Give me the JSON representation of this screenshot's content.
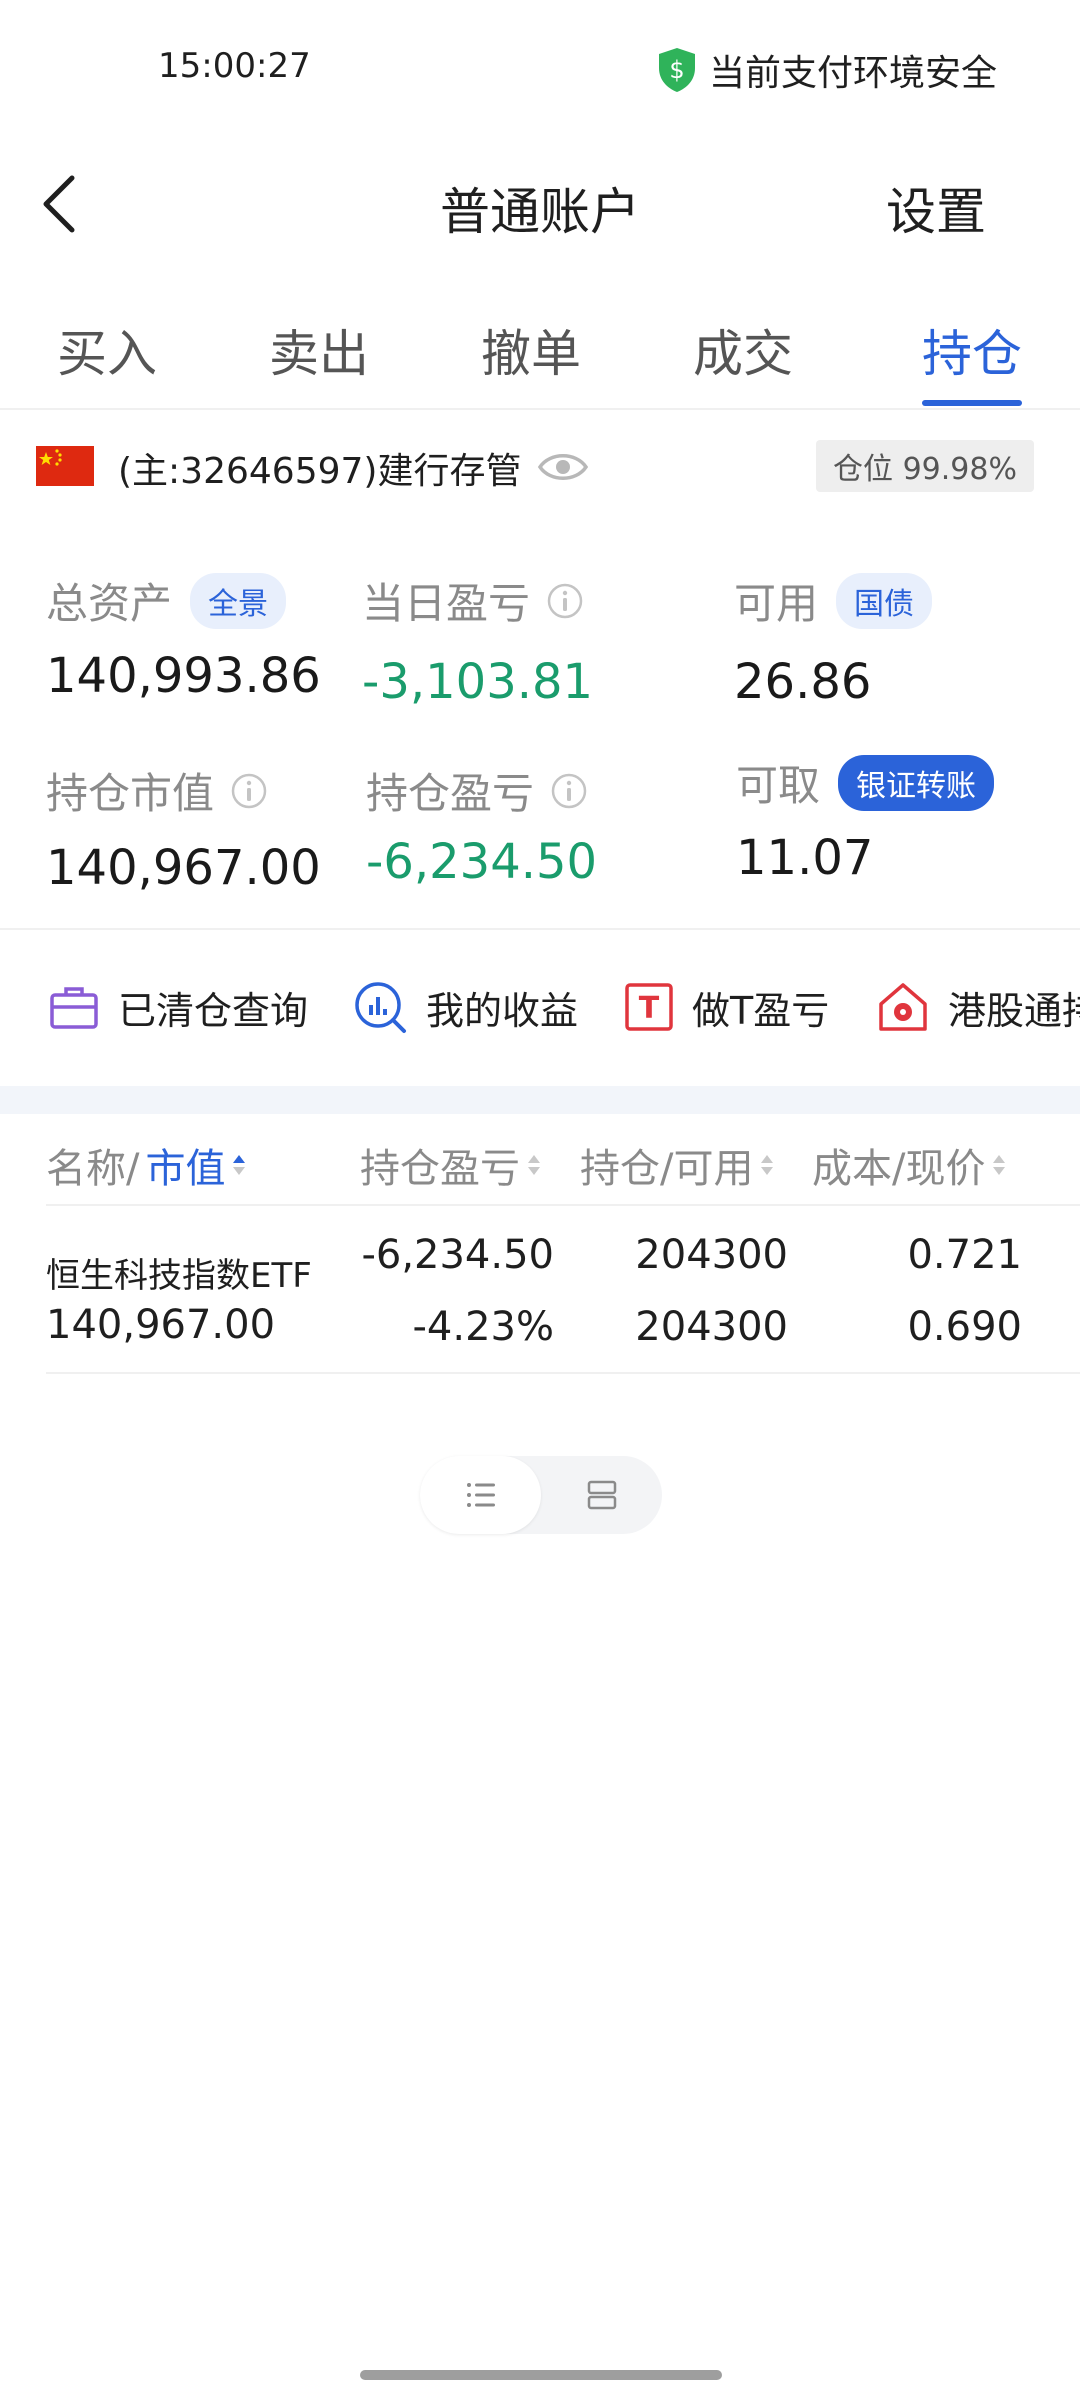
{
  "status_bar": {
    "time": "15:00:27",
    "security_text": "当前支付环境安全"
  },
  "header": {
    "title": "普通账户",
    "settings_label": "设置"
  },
  "tabs": [
    {
      "label": "买入",
      "active": false
    },
    {
      "label": "卖出",
      "active": false
    },
    {
      "label": "撤单",
      "active": false
    },
    {
      "label": "成交",
      "active": false
    },
    {
      "label": "持仓",
      "active": true
    }
  ],
  "account": {
    "flag_icon": "china-flag-icon",
    "label": "(主:32646597)建行存管",
    "position_ratio": "仓位 99.98%"
  },
  "metrics": {
    "total_assets": {
      "label": "总资产",
      "badge": "全景",
      "value": "140,993.86"
    },
    "daily_pnl": {
      "label": "当日盈亏",
      "value": "-3,103.81"
    },
    "available": {
      "label": "可用",
      "badge": "国债",
      "value": "26.86"
    },
    "holdings_value": {
      "label": "持仓市值",
      "value": "140,967.00"
    },
    "holdings_pnl": {
      "label": "持仓盈亏",
      "value": "-6,234.50"
    },
    "withdrawable": {
      "label": "可取",
      "badge": "银证转账",
      "value": "11.07"
    }
  },
  "shortcuts": [
    {
      "label": "已清仓查询",
      "icon": "briefcase-icon"
    },
    {
      "label": "我的收益",
      "icon": "chart-search-icon"
    },
    {
      "label": "做T盈亏",
      "icon": "t-box-icon"
    },
    {
      "label": "港股通持",
      "icon": "hk-house-icon"
    }
  ],
  "table": {
    "headers": {
      "name_prefix": "名称/",
      "name_active": "市值",
      "pnl": "持仓盈亏",
      "qty": "持仓/可用",
      "price": "成本/现价"
    },
    "rows": [
      {
        "name": "恒生科技指数ETF",
        "market_value": "140,967.00",
        "pnl": "-6,234.50",
        "pnl_pct": "-4.23%",
        "holding": "204300",
        "available": "204300",
        "cost": "0.721",
        "current": "0.690"
      }
    ]
  },
  "colors": {
    "accent": "#2b63d9",
    "loss_green": "#1a9c6c",
    "muted": "#8a8a8a"
  }
}
